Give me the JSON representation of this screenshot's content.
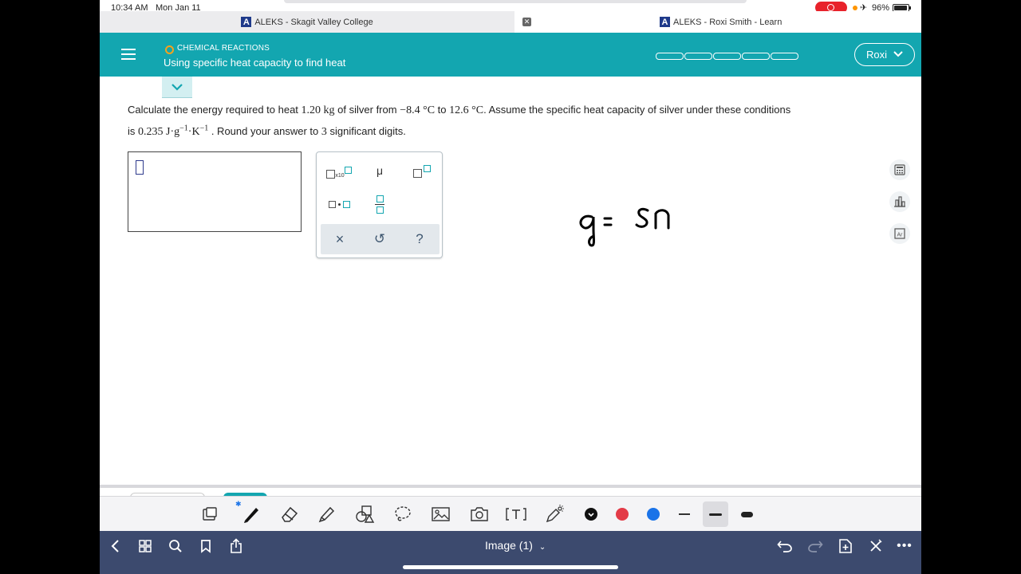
{
  "status": {
    "time": "10:34 AM",
    "date": "Mon Jan 11",
    "battery": "96%"
  },
  "browser": {
    "tabs": [
      {
        "label": "ALEKS - Skagit Valley College"
      },
      {
        "label": "ALEKS - Roxi Smith - Learn"
      }
    ]
  },
  "header": {
    "topic": "CHEMICAL REACTIONS",
    "title": "Using specific heat capacity to find heat",
    "user": "Roxi",
    "progress_segments": 5,
    "colors": {
      "teal": "#13a6b0",
      "topic_dot": "#f7a21b"
    }
  },
  "question": {
    "part1": "Calculate the energy required to heat",
    "mass": "1.20 kg",
    "part2": "of silver from",
    "t1": "−8.4 °C",
    "part3": "to",
    "t2": "12.6 °C",
    "part4": ". Assume the specific heat capacity of silver under these conditions",
    "part5": "is",
    "c_value": "0.235 J·g",
    "exp1": "−1",
    "unit_k": "·K",
    "exp2": "−1",
    "part6": ". Round your answer to",
    "sig": "3",
    "part7": "significant digits."
  },
  "keypad": {
    "x10_label": "x10",
    "mu": "μ",
    "clear": "×",
    "undo": "↺",
    "help": "?"
  },
  "handwriting": "q= sn",
  "toolbar": {
    "colors": [
      "#111111",
      "#e33b47",
      "#1a73e8"
    ]
  },
  "bottom_nav": {
    "title": "Image (1)"
  }
}
